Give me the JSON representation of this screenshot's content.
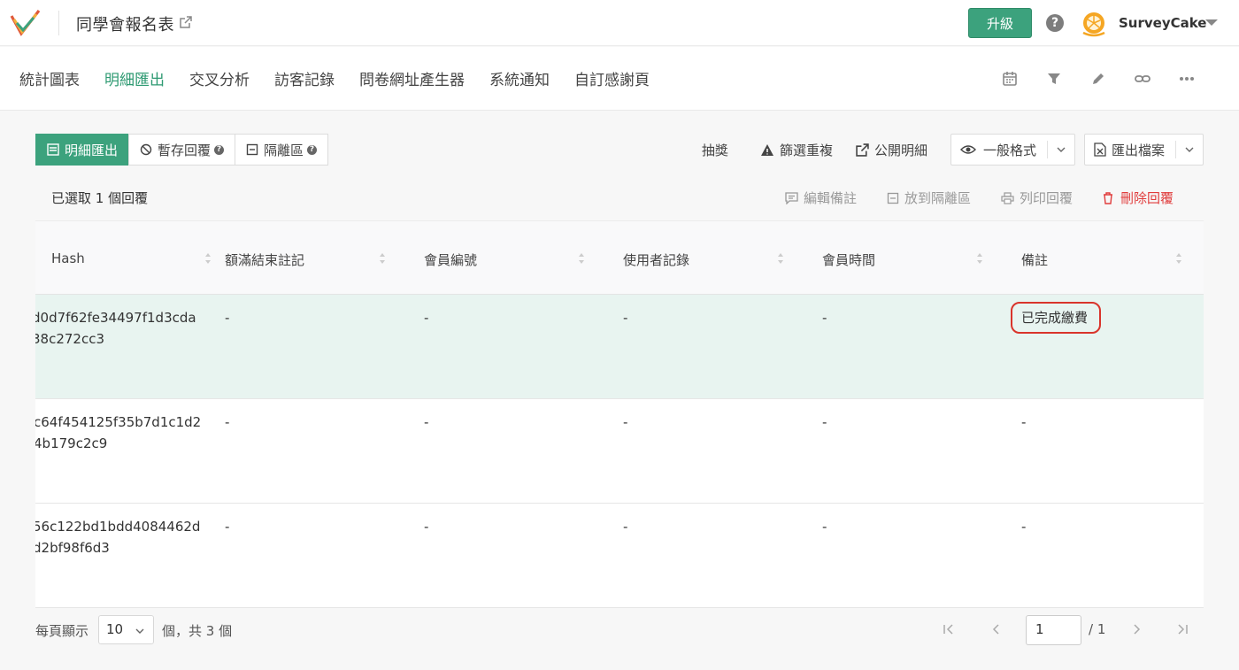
{
  "header": {
    "survey_title": "同學會報名表",
    "upgrade_label": "升級",
    "help_glyph": "?",
    "username": "SurveyCake",
    "brand_color": "#3ca27d"
  },
  "nav": {
    "tabs": [
      {
        "label": "統計圖表",
        "active": false
      },
      {
        "label": "明細匯出",
        "active": true
      },
      {
        "label": "交叉分析",
        "active": false
      },
      {
        "label": "訪客記錄",
        "active": false
      },
      {
        "label": "問卷網址產生器",
        "active": false
      },
      {
        "label": "系統通知",
        "active": false
      },
      {
        "label": "自訂感謝頁",
        "active": false
      }
    ],
    "tools": [
      "calendar-icon",
      "filter-icon",
      "pencil-icon",
      "link-icon",
      "more-icon"
    ]
  },
  "toolbar": {
    "segments": [
      {
        "label": "明細匯出",
        "icon": "list-icon",
        "active": true
      },
      {
        "label": "暫存回覆",
        "icon": "ban-icon",
        "active": false
      },
      {
        "label": "隔離區",
        "icon": "minus-box-icon",
        "active": false
      }
    ],
    "lottery_label": "抽獎",
    "filter_dup_label": "篩選重複",
    "public_detail_label": "公開明細",
    "format_label": "一般格式",
    "export_label": "匯出檔案"
  },
  "selection": {
    "info": "已選取 1 個回覆",
    "edit_note": "編輯備註",
    "move_isolation": "放到隔離區",
    "print": "列印回覆",
    "delete": "刪除回覆"
  },
  "table": {
    "columns": [
      "Hash",
      "額滿結束註記",
      "會員編號",
      "使用者記錄",
      "會員時間",
      "備註"
    ],
    "rows": [
      {
        "hash1": "d0d7f62fe34497f1d3cda",
        "hash2": "38c272cc3",
        "c1": "-",
        "c2": "-",
        "c3": "-",
        "c4": "-",
        "note": "已完成繳費",
        "selected": true
      },
      {
        "hash1": "c64f454125f35b7d1c1d2",
        "hash2": "4b179c2c9",
        "c1": "-",
        "c2": "-",
        "c3": "-",
        "c4": "-",
        "note": "-",
        "selected": false
      },
      {
        "hash1": "56c122bd1bdd4084462d",
        "hash2": "d2bf98f6d3",
        "c1": "-",
        "c2": "-",
        "c3": "-",
        "c4": "-",
        "note": "-",
        "selected": false
      }
    ]
  },
  "pager": {
    "per_page_label": "每頁顯示",
    "per_page_value": "10",
    "total_label": "個，共 3 個",
    "current_page": "1",
    "total_pages": "/ 1"
  }
}
